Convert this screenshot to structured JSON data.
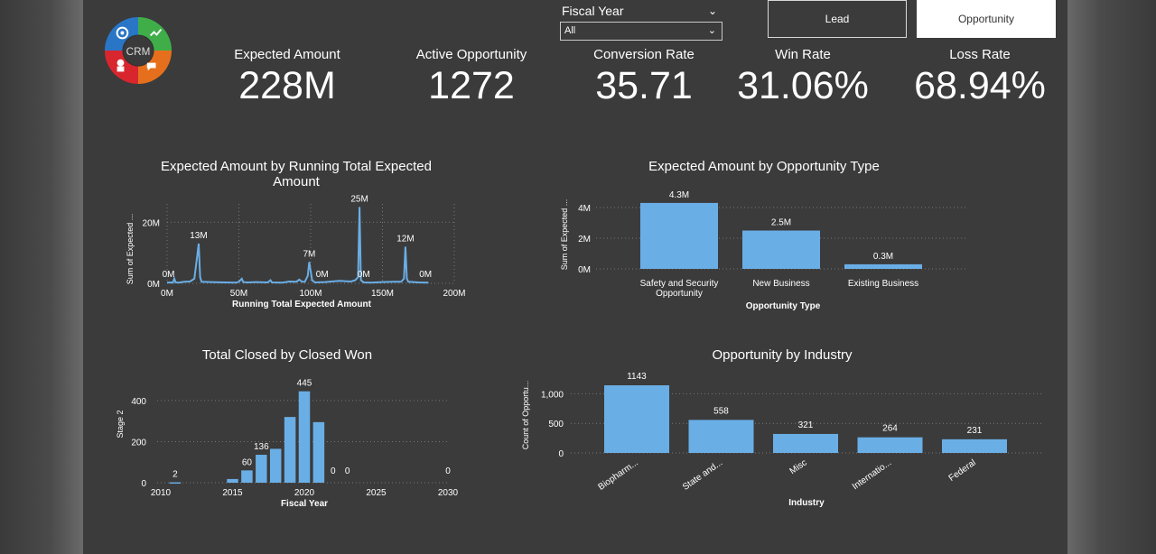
{
  "logo": {
    "text": "CRM"
  },
  "slicer": {
    "title": "Fiscal Year",
    "value": "All"
  },
  "nav": {
    "lead": "Lead",
    "opportunity": "Opportunity"
  },
  "kpis": [
    {
      "label": "Expected Amount",
      "value": "228M"
    },
    {
      "label": "Active Opportunity",
      "value": "1272"
    },
    {
      "label": "Conversion Rate",
      "value": "35.71"
    },
    {
      "label": "Win Rate",
      "value": "31.06%"
    },
    {
      "label": "Loss Rate",
      "value": "68.94%"
    }
  ],
  "chart_data": [
    {
      "type": "line",
      "title": "Expected Amount by Running Total Expected Amount",
      "xlabel": "Running Total Expected Amount",
      "ylabel": "Sum of Expected ...",
      "xlim": [
        0,
        200
      ],
      "ylim": [
        0,
        26
      ],
      "x_ticks": [
        "0M",
        "50M",
        "100M",
        "150M",
        "200M"
      ],
      "y_ticks": [
        "0M",
        "20M"
      ],
      "points": [
        [
          0,
          0.2
        ],
        [
          2,
          0.3
        ],
        [
          4,
          0.2
        ],
        [
          5,
          1.5
        ],
        [
          6,
          0.3
        ],
        [
          8,
          0.2
        ],
        [
          12,
          0.5
        ],
        [
          16,
          0.6
        ],
        [
          19,
          1.5
        ],
        [
          21,
          9
        ],
        [
          22,
          13
        ],
        [
          23,
          2
        ],
        [
          24,
          0.5
        ],
        [
          30,
          0.4
        ],
        [
          40,
          0.3
        ],
        [
          48,
          0.2
        ],
        [
          50,
          0.5
        ],
        [
          52,
          1.5
        ],
        [
          53,
          0.4
        ],
        [
          56,
          0.3
        ],
        [
          62,
          0.4
        ],
        [
          70,
          0.3
        ],
        [
          72,
          1.0
        ],
        [
          73,
          0.3
        ],
        [
          80,
          0.2
        ],
        [
          85,
          0.6
        ],
        [
          90,
          0.5
        ],
        [
          92,
          1.2
        ],
        [
          94,
          0.5
        ],
        [
          96,
          0.5
        ],
        [
          98,
          2.5
        ],
        [
          99,
          7
        ],
        [
          100,
          4
        ],
        [
          101,
          1.0
        ],
        [
          103,
          0.3
        ],
        [
          110,
          0.4
        ],
        [
          120,
          0.8
        ],
        [
          128,
          0.6
        ],
        [
          131,
          1.0
        ],
        [
          133,
          2
        ],
        [
          134,
          25
        ],
        [
          135,
          1.0
        ],
        [
          137,
          0.3
        ],
        [
          142,
          0.2
        ],
        [
          150,
          0.4
        ],
        [
          158,
          0.5
        ],
        [
          163,
          0.5
        ],
        [
          165,
          1.5
        ],
        [
          166,
          12
        ],
        [
          167,
          1.5
        ],
        [
          168,
          0.5
        ],
        [
          175,
          0.3
        ],
        [
          182,
          0.2
        ]
      ],
      "labels": [
        {
          "x": 1,
          "y": 0.3,
          "text": "0M"
        },
        {
          "x": 22,
          "y": 13,
          "text": "13M"
        },
        {
          "x": 99,
          "y": 7,
          "text": "7M"
        },
        {
          "x": 108,
          "y": 0.3,
          "text": "0M"
        },
        {
          "x": 134,
          "y": 25,
          "text": "25M"
        },
        {
          "x": 137,
          "y": 0.3,
          "text": "0M"
        },
        {
          "x": 166,
          "y": 12,
          "text": "12M"
        },
        {
          "x": 180,
          "y": 0.3,
          "text": "0M"
        }
      ]
    },
    {
      "type": "bar",
      "title": "Expected Amount by Opportunity Type",
      "xlabel": "Opportunity Type",
      "ylabel": "Sum of Expected ...",
      "ylim": [
        0,
        5
      ],
      "y_ticks": [
        "0M",
        "2M",
        "4M"
      ],
      "categories": [
        "Safety and Security Opportunity",
        "New Business",
        "Existing Business"
      ],
      "values": [
        4.3,
        2.5,
        0.3
      ],
      "value_labels": [
        "4.3M",
        "2.5M",
        "0.3M"
      ]
    },
    {
      "type": "bar",
      "title": "Total Closed by Closed Won",
      "xlabel": "Fiscal Year",
      "ylabel": "Stage 2",
      "xlim": [
        2010,
        2030
      ],
      "ylim": [
        0,
        470
      ],
      "x_ticks": [
        "2010",
        "2015",
        "2020",
        "2025",
        "2030"
      ],
      "y_ticks": [
        "0",
        "200",
        "400"
      ],
      "x": [
        2011,
        2015,
        2016,
        2017,
        2018,
        2019,
        2020,
        2021,
        2022,
        2023,
        2030
      ],
      "values": [
        2,
        18,
        60,
        136,
        165,
        320,
        445,
        295,
        0,
        0,
        0
      ],
      "labels": [
        {
          "x": 2011,
          "text": "2"
        },
        {
          "x": 2016,
          "text": "60"
        },
        {
          "x": 2017,
          "text": "136"
        },
        {
          "x": 2020,
          "text": "445"
        },
        {
          "x": 2022,
          "text": "0"
        },
        {
          "x": 2023,
          "text": "0"
        },
        {
          "x": 2030,
          "text": "0"
        }
      ]
    },
    {
      "type": "bar",
      "title": "Opportunity by Industry",
      "xlabel": "Industry",
      "ylabel": "Count of Opportu...",
      "ylim": [
        0,
        1250
      ],
      "y_ticks": [
        "0",
        "500",
        "1,000"
      ],
      "categories": [
        "Biopharm...",
        "State and...",
        "Misc",
        "Internatio...",
        "Federal"
      ],
      "values": [
        1143,
        558,
        321,
        264,
        231
      ]
    }
  ],
  "colors": {
    "bar": "#6aaee6",
    "background": "#3b3b3b",
    "grid": "#777777"
  }
}
